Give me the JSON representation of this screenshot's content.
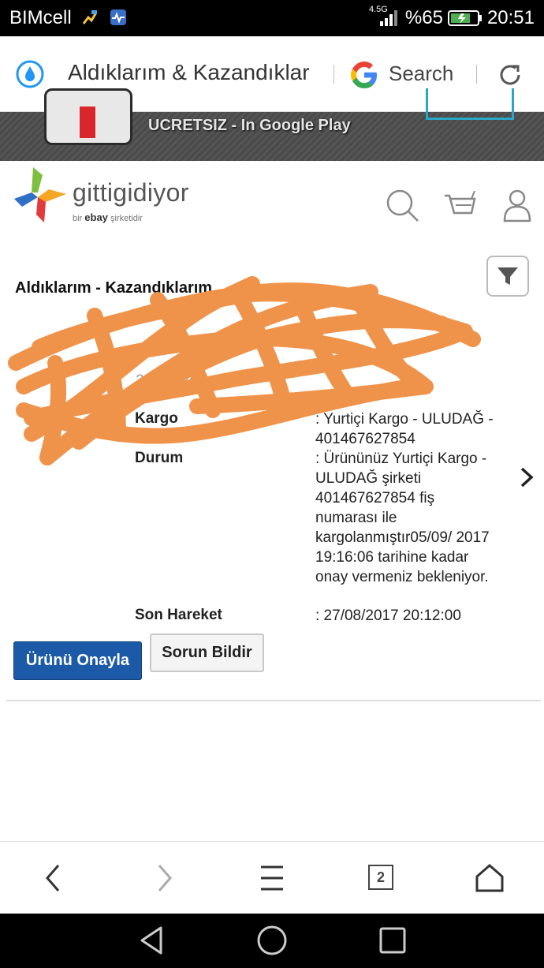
{
  "status_bar": {
    "carrier": "BIMcell",
    "network": "4.5G",
    "battery": "%65",
    "time": "20:51"
  },
  "browser_bar": {
    "title": "Aldıklarım & Kazandıklar",
    "search_label": "Search"
  },
  "app_banner": {
    "text": "UCRETSIZ - In Google Play"
  },
  "site": {
    "logo_text": "gittigidiyor",
    "logo_sub_prefix": "bir ",
    "logo_sub_brand": "ebay",
    "logo_sub_suffix": " şirketidir"
  },
  "content": {
    "heading": "Aldıklarım - Kazandıklarım",
    "partial_date": "29/…604",
    "fields": [
      {
        "label": "Kargo",
        "value": ": Yurtiçi Kargo - ULUDAĞ - 401467627854"
      },
      {
        "label": "Durum",
        "value": ": Ürününüz Yurtiçi Kargo - ULUDAĞ şirketi 401467627854 fiş numarası ile kargolanmıştır05/09/ 2017 19:16:06 tarihine kadar onay vermeniz bekleniyor."
      },
      {
        "label": "Son Hareket",
        "value": ": 27/08/2017 20:12:00"
      }
    ],
    "confirm_button": "Ürünü Onayla",
    "report_button": "Sorun Bildir"
  },
  "bottom_nav": {
    "tab_count": "2"
  },
  "colors": {
    "primary_button": "#1c5aa8",
    "scribble": "#f0934a",
    "browser_accent": "#2196f3"
  }
}
